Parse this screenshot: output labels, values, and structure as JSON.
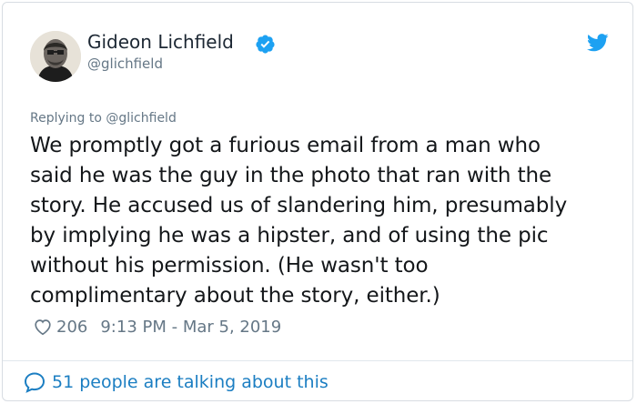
{
  "tweet": {
    "author": {
      "name": "Gideon Lichfield",
      "handle": "@glichfield",
      "verified": true
    },
    "icons": {
      "avatar": "user-avatar-photo",
      "verified": "verified-badge-icon",
      "brand": "twitter-bird-icon",
      "like": "heart-outline-icon",
      "reply": "speech-bubble-icon"
    },
    "replying_to": {
      "prefix": "Replying to",
      "handle": "@glichfield"
    },
    "text_lines": [
      "We promptly got a furious email from a man who",
      "said he was the guy in the photo that ran with the",
      "story. He accused us of slandering him, presumably",
      "by implying he was a hipster, and of using the pic",
      "without his permission. (He wasn't too",
      "complimentary about the story, either.)"
    ],
    "likes": "206",
    "timestamp": "9:13 PM - Mar 5, 2019",
    "talking": "51 people are talking about this"
  },
  "colors": {
    "accent": "#1da1f2",
    "link": "#1b7ec2",
    "text": "#14171a",
    "muted": "#657786",
    "border": "#d8dde2"
  }
}
